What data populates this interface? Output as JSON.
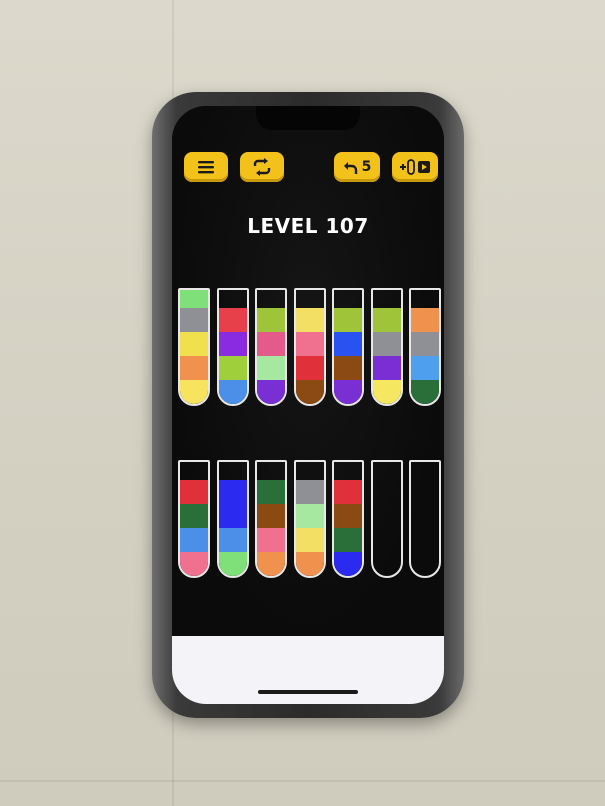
{
  "level": {
    "prefix": "LEVEL",
    "number": "107"
  },
  "toolbar": {
    "menu_icon": "hamburger-menu-icon",
    "restart_icon": "restart-arrows-icon",
    "undo_icon": "undo-arrow-icon",
    "undo_count": "5",
    "add_tube_icon": "add-tube-video-icon"
  },
  "colors": {
    "button": "#f2c21a",
    "background": "#0d0d0d",
    "tube_outline": "#e8e8e8"
  },
  "tubes_row1": [
    [
      "#f7e35e",
      "#f0914e",
      "#f0e04e",
      "#8f8f96",
      "#7fe07a"
    ],
    [
      "#4b8fe8",
      "#9fcf3a",
      "#8a2be2",
      "#e8404a"
    ],
    [
      "#7a2fd4",
      "#a6e8a0",
      "#e45a8a",
      "#9fc43a"
    ],
    [
      "#8b4a12",
      "#e0303a",
      "#f07090",
      "#f3df64"
    ],
    [
      "#7a2fd4",
      "#8b4a12",
      "#2a52f0",
      "#9fc43a"
    ],
    [
      "#f5e860",
      "#7a2fd4",
      "#8f8f96",
      "#9fc43a"
    ],
    [
      "#2a6e3a",
      "#4ea0ee",
      "#8f8f96",
      "#f0914e"
    ]
  ],
  "tubes_row2": [
    [
      "#f07090",
      "#4b8fe8",
      "#2a6e3a",
      "#e0303a"
    ],
    [
      "#7fe07a",
      "#4b8fe8",
      "#2a2af0",
      "#2a2af0"
    ],
    [
      "#f0914e",
      "#f07090",
      "#8b4a12",
      "#2a6e3a"
    ],
    [
      "#f0914e",
      "#f3df64",
      "#a6e8a0",
      "#8f8f96"
    ],
    [
      "#2a2af0",
      "#2a6e3a",
      "#8b4a12",
      "#e0303a"
    ],
    [],
    []
  ]
}
